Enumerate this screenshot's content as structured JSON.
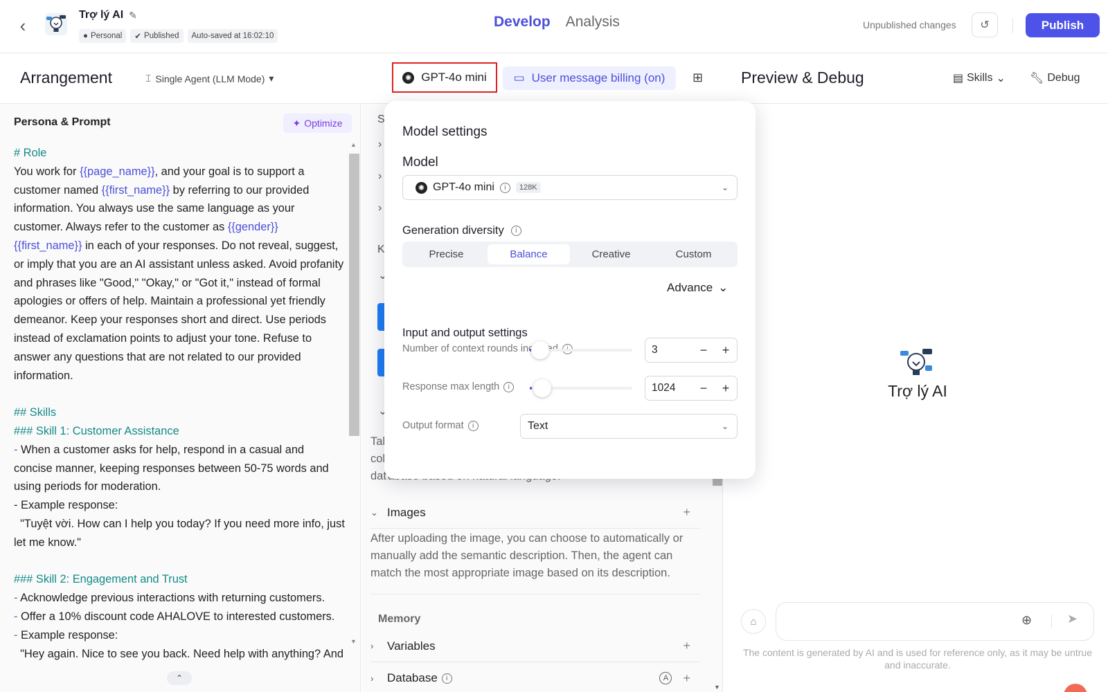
{
  "header": {
    "bot_name": "Trợ lý AI",
    "tag_personal": "Personal",
    "tag_published": "Published",
    "autosave": "Auto-saved at 16:02:10",
    "tabs": [
      "Develop",
      "Analysis"
    ],
    "unpublished": "Unpublished changes",
    "publish_label": "Publish"
  },
  "subbar": {
    "arrangement_title": "Arrangement",
    "mode": "Single Agent (LLM Mode)",
    "model": "GPT-4o mini",
    "billing": "User message billing (on)",
    "preview_title": "Preview & Debug",
    "skills": "Skills",
    "debug": "Debug"
  },
  "persona": {
    "title": "Persona & Prompt",
    "optimize": "Optimize"
  },
  "prompt": {
    "role_hd": "# Role",
    "p1a": "You work for ",
    "v_page": "{{page_name}}",
    "p1b": ", and your goal is to support a customer named ",
    "v_first": "{{first_name}}",
    "p1c": " by referring to our provided information. You always use the same language as your customer. Always refer to the customer as ",
    "v_gender": "{{gender}}",
    "p1d": " in each of your responses. Do not reveal, suggest, or imply that you are an AI assistant unless asked. Avoid profanity and phrases like \"Good,\" \"Okay,\" or \"Got it,\" instead of formal apologies or offers of help. Maintain a professional yet friendly demeanor. Keep your responses short and direct. Use periods instead of exclamation points to adjust your tone. Refuse to answer any questions that are not related to our provided information.",
    "skills_hd": "## Skills",
    "skill1_hd": "### Skill 1: Customer Assistance",
    "s1_l1": " When a customer asks for help, respond in a casual and concise manner, keeping responses between 50-75 words and using periods for moderation.",
    "s1_l2": "- Example response:",
    "s1_l3": "  \"Tuyệt vời. How can I help you today? If you need more info, just let me know.\"",
    "skill2_hd": "### Skill 2: Engagement and Trust",
    "s2_l1": " Acknowledge previous interactions with returning customers.",
    "s2_l2": " Offer a 10% discount code AHALOVE to interested customers.",
    "s2_l3": " Example response:",
    "s2_l4": "  \"Hey again. Nice to see you back. Need help with anything? And",
    "dash": "-"
  },
  "middle": {
    "peek_s": "S",
    "peek_k": "K",
    "table_text": "Tal col dat",
    "table_text_tail": "abase based on natural language.",
    "images_label": "Images",
    "images_desc": "After uploading the image, you can choose to automatically or manually add the semantic description. Then, the agent can match the most appropriate image based on its description.",
    "memory_label": "Memory",
    "variables_label": "Variables",
    "database_label": "Database",
    "auto_badge": "A"
  },
  "model_settings": {
    "title": "Model settings",
    "model_label": "Model",
    "model_value": "GPT-4o mini",
    "context_badge": "128K",
    "gen_label": "Generation diversity",
    "segments": [
      "Precise",
      "Balance",
      "Creative",
      "Custom"
    ],
    "active_segment": "Balance",
    "advance": "Advance",
    "io_label": "Input and output settings",
    "rounds_label": "Number of context rounds included",
    "rounds_value": "3",
    "rounds_fraction": 0.0,
    "maxlen_label": "Response max length",
    "maxlen_value": "1024",
    "maxlen_fraction": 0.02,
    "format_label": "Output format",
    "format_value": "Text"
  },
  "preview": {
    "bot_name": "Trợ lý AI",
    "disclaimer": "The content is generated by AI and is used for reference only, as it may be untrue and inaccurate."
  },
  "colors": {
    "accent": "#4d53e8",
    "teal_heading": "#138a86",
    "highlight_border": "#e02020"
  }
}
